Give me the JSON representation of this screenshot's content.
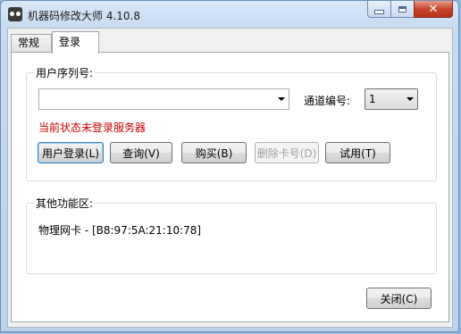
{
  "window": {
    "title": "机器码修改大师 4.10.8"
  },
  "tabs": [
    {
      "label": "常规"
    },
    {
      "label": "登录"
    }
  ],
  "serial_group": {
    "label": "用户序列号:",
    "serial_input": {
      "value": ""
    },
    "channel_label": "通道编号:",
    "channel_value": "1",
    "status": "当前状态未登录服务器",
    "buttons": {
      "login": "用户登录(L)",
      "query": "查询(V)",
      "buy": "购买(B)",
      "delete_card": "删除卡号(D)",
      "trial": "试用(T)"
    }
  },
  "other_group": {
    "label": "其他功能区:",
    "nic": "物理网卡 - [B8:97:5A:21:10:78]"
  },
  "close_button": "关闭(C)",
  "colors": {
    "status_text": "#cc0000",
    "accent": "#3c7fb1"
  }
}
